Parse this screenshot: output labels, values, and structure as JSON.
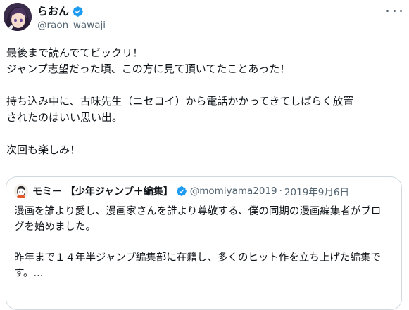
{
  "author": {
    "display_name": "らおん",
    "handle": "@raon_wawaji",
    "verified_color": "#1d9bf0"
  },
  "tweet": {
    "lines": [
      "最後まで読んでてビックリ！",
      "ジャンプ志望だった頃、この方に見て頂いてたことあった！",
      "",
      "持ち込み中に、古味先生（ニセコイ）から電話かかってきてしばらく放置",
      "されたのはいい思い出。",
      "",
      "次回も楽しみ！"
    ]
  },
  "quote": {
    "display_name": "モミー 【少年ジャンプ＋編集】",
    "handle": "@momiyama2019",
    "separator": "·",
    "date": "2019年9月6日",
    "lines": [
      "漫画を誰より愛し、漫画家さんを誰より尊敬する、僕の同期の漫画編集者がブロ",
      "グを始めました。",
      "",
      "昨年まで１４年半ジャンプ編集部に在籍し、多くのヒット作を立ち上げた編集で",
      "す。..."
    ]
  },
  "icons": {
    "avatar": "anime-avatar-icon",
    "verified": "verified-badge-icon",
    "more": "more-options-icon",
    "quote_avatar": "quote-avatar-icon"
  }
}
